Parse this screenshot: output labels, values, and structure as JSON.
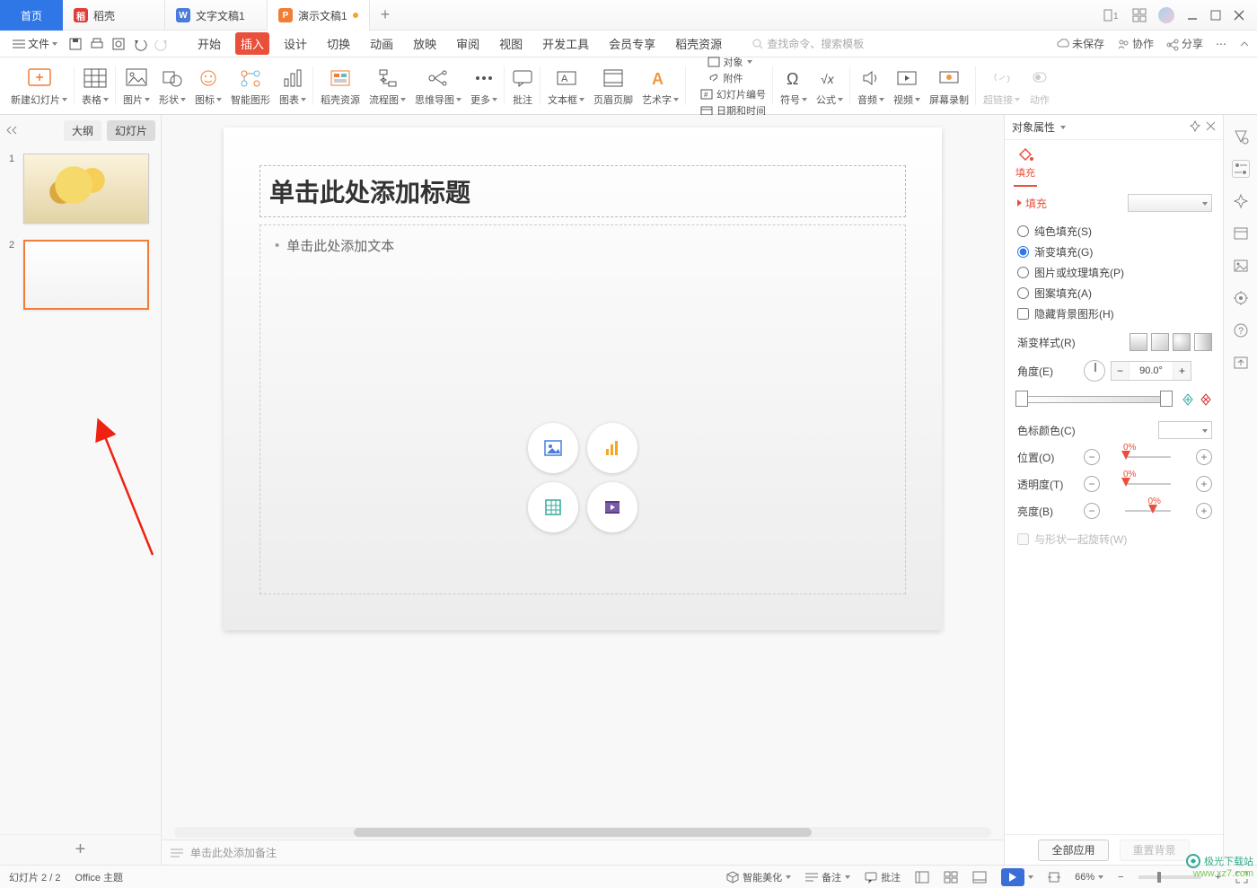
{
  "tabs": {
    "home": "首页",
    "docker": "稻壳",
    "word": "文字文稿1",
    "ppt": "演示文稿1"
  },
  "quick": {
    "file": "文件"
  },
  "menus": [
    "开始",
    "插入",
    "设计",
    "切换",
    "动画",
    "放映",
    "审阅",
    "视图",
    "开发工具",
    "会员专享",
    "稻壳资源"
  ],
  "activeMenu": 1,
  "search": "查找命令、搜索模板",
  "topright": {
    "unsaved": "未保存",
    "coop": "协作",
    "share": "分享"
  },
  "ribbon": {
    "newslide": "新建幻灯片",
    "table": "表格",
    "image": "图片",
    "shape": "形状",
    "icon": "图标",
    "smart": "智能图形",
    "chart": "图表",
    "dkres": "稻壳资源",
    "flow": "流程图",
    "mind": "思维导图",
    "more": "更多",
    "comment": "批注",
    "textbox": "文本框",
    "header": "页眉页脚",
    "wordart": "艺术字",
    "object": "对象",
    "attach": "附件",
    "slidenum": "幻灯片编号",
    "datetime": "日期和时间",
    "symbol": "符号",
    "formula": "公式",
    "audio": "音频",
    "video": "视频",
    "screen": "屏幕录制",
    "hyperlink": "超链接",
    "action": "动作"
  },
  "panel": {
    "outline": "大纲",
    "slides": "幻灯片"
  },
  "slide": {
    "title": "单击此处添加标题",
    "body": "单击此处添加文本",
    "notes": "单击此处添加备注"
  },
  "prop": {
    "header": "对象属性",
    "tab": "填充",
    "section": "填充",
    "solid": "纯色填充(S)",
    "grad": "渐变填充(G)",
    "pic": "图片或纹理填充(P)",
    "pattern": "图案填充(A)",
    "hide": "隐藏背景图形(H)",
    "gradstyle": "渐变样式(R)",
    "angle": "角度(E)",
    "angleval": "90.0°",
    "stopcolor": "色标颜色(C)",
    "position": "位置(O)",
    "trans": "透明度(T)",
    "bright": "亮度(B)",
    "rotate": "与形状一起旋转(W)",
    "pct": "0%",
    "applyall": "全部应用",
    "reset": "重置背景"
  },
  "status": {
    "slide": "幻灯片 2 / 2",
    "theme": "Office 主题",
    "beautify": "智能美化",
    "notes": "备注",
    "comments": "批注",
    "zoom": "66%"
  },
  "watermark": {
    "name": "极光下载站",
    "url": "www.xz7.com"
  }
}
